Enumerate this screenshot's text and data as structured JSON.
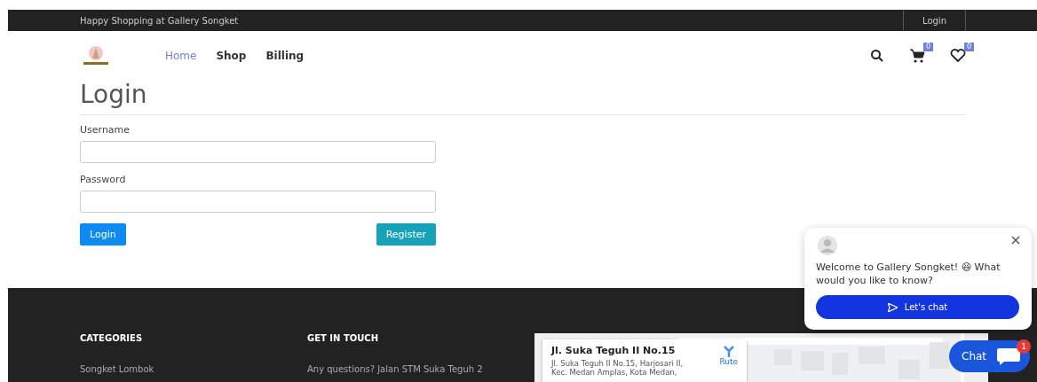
{
  "topbar": {
    "message": "Happy Shopping at Gallery Songket",
    "login": "Login"
  },
  "nav": {
    "links": [
      {
        "label": "Home",
        "selected": true
      },
      {
        "label": "Shop",
        "selected": false
      },
      {
        "label": "Billing",
        "selected": false
      }
    ],
    "cart_count": "0",
    "wishlist_count": "0"
  },
  "page": {
    "title": "Login",
    "fields": [
      {
        "label": "Username"
      },
      {
        "label": "Password"
      }
    ],
    "login_button": "Login",
    "register_button": "Register"
  },
  "footer": {
    "columns": [
      {
        "heading": "CATEGORIES",
        "items": [
          "Songket Lombok"
        ]
      },
      {
        "heading": "GET IN TOUCH",
        "items": [
          "Any questions? Jalan STM Suka Teguh 2"
        ]
      }
    ],
    "map": {
      "place": "Jl. Suka Teguh II No.15",
      "address": "Jl. Suka Teguh II No.15, Harjosari II, Kec. Medan Amplas, Kota Medan,",
      "route": "Rute"
    }
  },
  "chat_popup": {
    "message": "Welcome to Gallery Songket! 😆 What would you like to know?",
    "button": "Let's chat"
  },
  "chat_launcher": {
    "label": "Chat",
    "unread": "1"
  }
}
